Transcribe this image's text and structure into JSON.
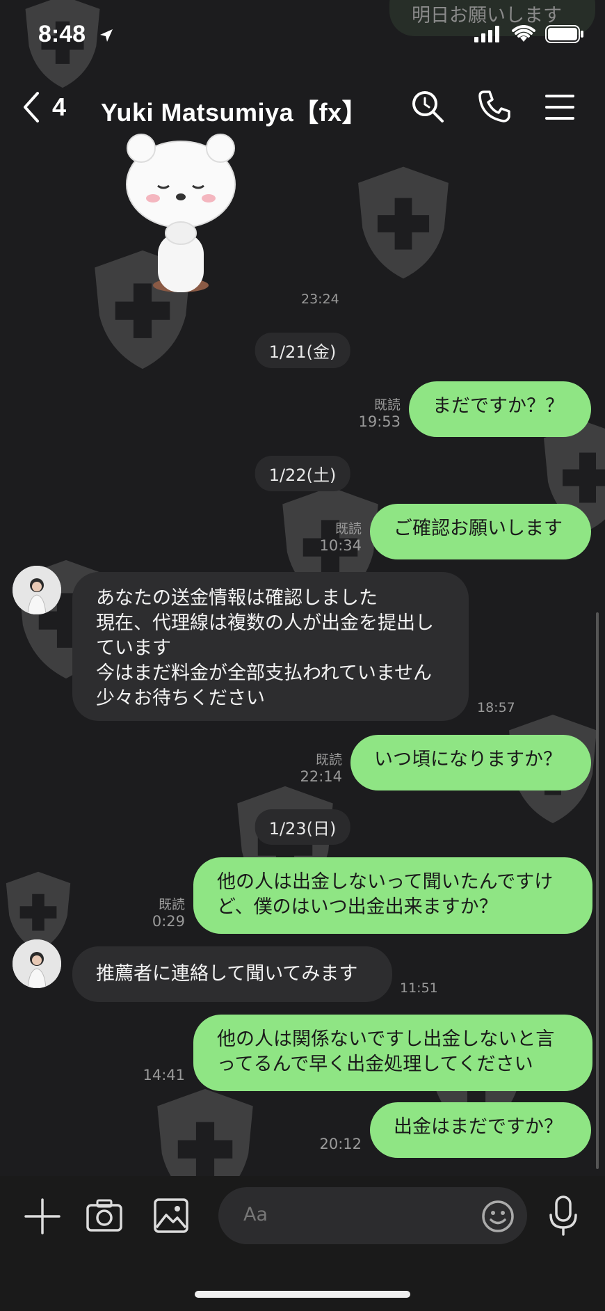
{
  "status_bar": {
    "time": "8:48"
  },
  "top_partial_message": "明日お願いします",
  "header": {
    "back_count": "4",
    "title": "Yuki  Matsumiya【fx】"
  },
  "sticker_message": {
    "time": "23:24"
  },
  "date_chips": [
    "1/21(金)",
    "1/22(土)",
    "1/23(日)"
  ],
  "messages": [
    {
      "text": "まだですか？？",
      "read": "既読",
      "time": "19:53"
    },
    {
      "text": "ご確認お願いします",
      "read": "既読",
      "time": "10:34"
    },
    {
      "text": "あなたの送金情報は確認しました\n現在、代理線は複数の人が出金を提出し\nています\n今はまだ料金が全部支払われていません\n少々お待ちください",
      "time": "18:57"
    },
    {
      "text": "いつ頃になりますか？",
      "read": "既読",
      "time": "22:14"
    },
    {
      "text": "他の人は出金しないって聞いたんですけ\nど、僕のはいつ出金出来ますか？",
      "read": "既読",
      "time": "0:29"
    },
    {
      "text": "推薦者に連絡して聞いてみます",
      "time": "11:51"
    },
    {
      "text": "他の人は関係ないですし出金しないと言\nってるんで早く出金処理してください",
      "time": "14:41"
    },
    {
      "text": "出金はまだですか？",
      "time": "20:12"
    }
  ],
  "input": {
    "placeholder": "Aa"
  },
  "icons": {
    "status": [
      "location-arrow-icon",
      "signal-icon",
      "wifi-icon",
      "battery-icon"
    ],
    "header": [
      "back-chevron-icon",
      "search-icon",
      "phone-icon",
      "menu-icon"
    ],
    "bottom": [
      "plus-icon",
      "camera-icon",
      "image-icon",
      "emoji-icon",
      "microphone-icon"
    ]
  },
  "colors": {
    "background": "#1c1c1e",
    "my_bubble": "#8fe584",
    "their_bubble": "#2d2d2f"
  }
}
